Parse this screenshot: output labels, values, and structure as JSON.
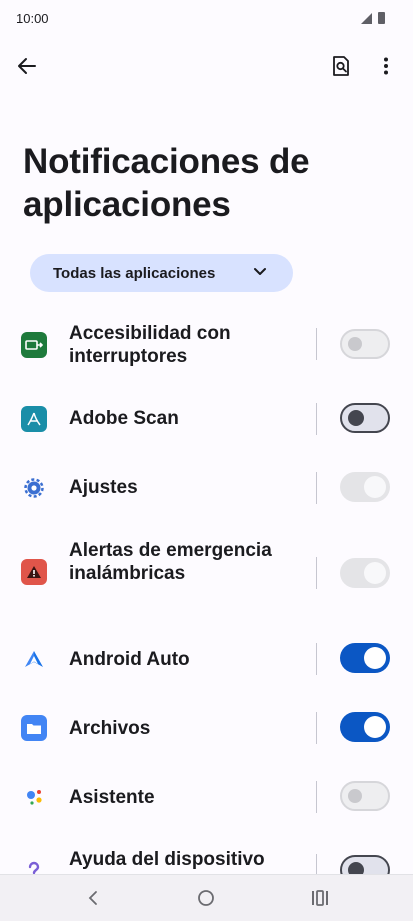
{
  "status_bar": {
    "time": "10:00"
  },
  "header": {
    "title": "Notificaciones de aplicaciones"
  },
  "filter": {
    "label": "Todas las aplicaciones"
  },
  "apps": [
    {
      "name": "Accesibilidad con interruptores",
      "icon": "switch-access-icon",
      "color": "#1e7a3c",
      "toggle": "off-disabled"
    },
    {
      "name": "Adobe Scan",
      "icon": "adobe-scan-icon",
      "color": "#1a8ea8",
      "toggle": "off"
    },
    {
      "name": "Ajustes",
      "icon": "settings-gear-icon",
      "color": "#3b6fd1",
      "toggle": "on-disabled"
    },
    {
      "name": "Alertas de emergencia inalámbricas",
      "icon": "emergency-alert-icon",
      "color": "#e0554a",
      "toggle": "on-disabled"
    },
    {
      "name": "Android Auto",
      "icon": "android-auto-icon",
      "color": "#3f86f4",
      "toggle": "on"
    },
    {
      "name": "Archivos",
      "icon": "folder-icon",
      "color": "#4285f4",
      "toggle": "on"
    },
    {
      "name": "Asistente",
      "icon": "assistant-icon",
      "color": "#4285f4",
      "toggle": "off-disabled"
    },
    {
      "name": "Ayuda del dispositivo",
      "icon": "help-icon",
      "color": "#7b5fd6",
      "toggle": "off"
    }
  ]
}
